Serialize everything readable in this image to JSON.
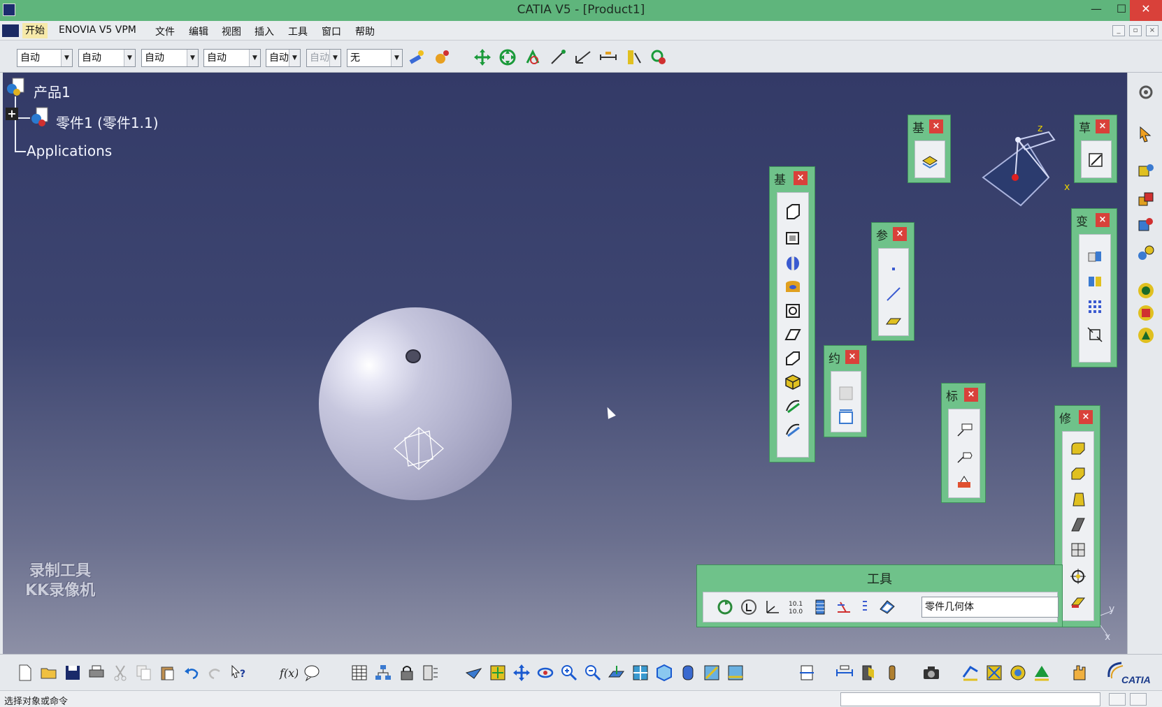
{
  "window": {
    "title": "CATIA V5 - [Product1]",
    "minimize": "—",
    "maximize": "☐",
    "close": "✕"
  },
  "menu": {
    "items": [
      "开始",
      "ENOVIA V5 VPM",
      "文件",
      "编辑",
      "视图",
      "插入",
      "工具",
      "窗口",
      "帮助"
    ],
    "mdi": [
      "_",
      "▫",
      "×"
    ]
  },
  "toolbar_top": {
    "combos": [
      "自动",
      "自动",
      "自动",
      "自动",
      "自动",
      "自动",
      "无"
    ]
  },
  "tree": {
    "root": "产品1",
    "child": "零件1 (零件1.1)",
    "applications": "Applications",
    "expand_symbol": "+"
  },
  "panels": {
    "base1": {
      "title": "基"
    },
    "base2": {
      "title": "基"
    },
    "sketch": {
      "title": "草"
    },
    "reference": {
      "title": "参"
    },
    "constraint": {
      "title": "约"
    },
    "annotation": {
      "title": "标"
    },
    "transform": {
      "title": "变"
    },
    "modify": {
      "title": "修"
    },
    "close_symbol": "×"
  },
  "tools_panel": {
    "title": "工具",
    "geometry_body": "零件几何体"
  },
  "compass": {
    "z": "z",
    "x": "x"
  },
  "axis": {
    "y": "y",
    "x": "x"
  },
  "watermark": {
    "line1": "录制工具",
    "line2": "KK录像机"
  },
  "status": {
    "prompt": "选择对象或命令"
  },
  "brand": {
    "logo": "CATIA"
  },
  "colors": {
    "title_bar": "#5fb57c",
    "panel": "#6fc28a",
    "close_red": "#d9413a",
    "viewport_top": "#333a67"
  }
}
